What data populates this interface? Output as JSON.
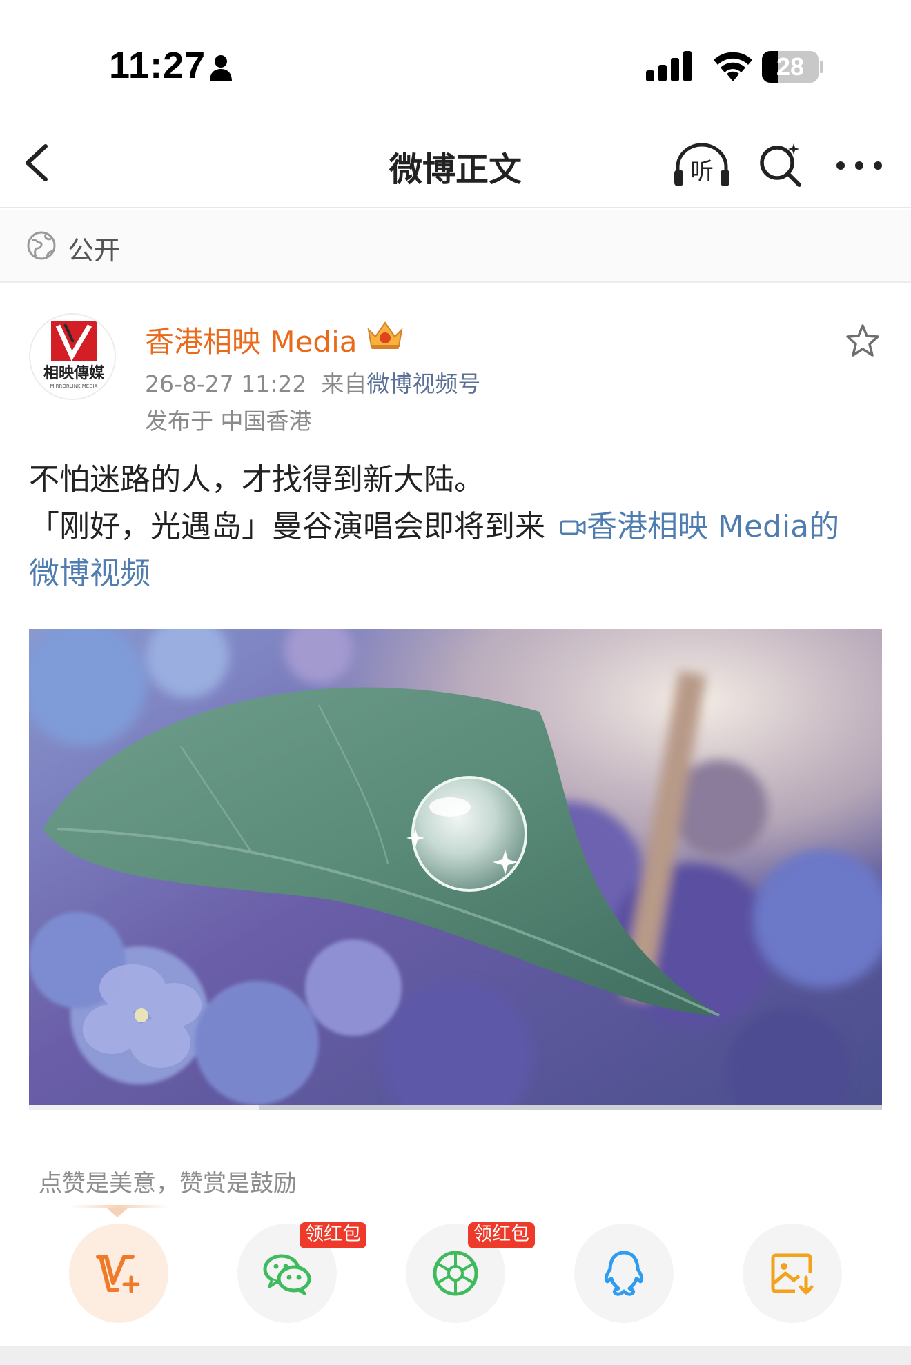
{
  "status_bar": {
    "time": "11:27",
    "battery": "28",
    "battery_fraction": 0.28,
    "icons": [
      "person-icon",
      "cellular-signal-icon",
      "wifi-icon",
      "battery-icon"
    ]
  },
  "nav": {
    "title": "微博正文",
    "listen_label": "听",
    "icons": [
      "back-icon",
      "listen-icon",
      "search-icon",
      "more-icon"
    ]
  },
  "visibility": {
    "label": "公开",
    "icon": "globe-icon"
  },
  "author": {
    "name": "香港相映 Media",
    "avatar_text": "相映傳媒",
    "avatar_subtext": "MIRRORLINK MEDIA",
    "badge_icon": "crown-icon"
  },
  "post": {
    "date": "26-8-27 11:22",
    "source_prefix": "来自",
    "source": "微博视频号",
    "location": "发布于 中国香港",
    "line1": "不怕迷路的人，才找得到新大陆。",
    "line2": "「刚好，光遇岛」曼谷演唱会即将到来",
    "video_link_part1": "香港相映 Media的",
    "video_link_part2": "微博视频"
  },
  "video": {
    "progress": 0.27
  },
  "reward": {
    "hint": "点赞是美意，赞赏是鼓励"
  },
  "share": {
    "badge_label": "领红包",
    "items": [
      {
        "name": "reward-button",
        "icon": "v-plus-icon",
        "color": "#ef7a2a",
        "has_badge": false
      },
      {
        "name": "wechat-share-button",
        "icon": "wechat-icon",
        "color": "#3fba5c",
        "has_badge": true
      },
      {
        "name": "moments-share-button",
        "icon": "moments-icon",
        "color": "#3fba5c",
        "has_badge": true
      },
      {
        "name": "qq-share-button",
        "icon": "qq-icon",
        "color": "#2f9cf0",
        "has_badge": false
      },
      {
        "name": "save-image-button",
        "icon": "save-image-icon",
        "color": "#f2a21c",
        "has_badge": false
      }
    ]
  },
  "colors": {
    "author_name": "#ea6a1c",
    "link": "#507daf",
    "badge": "#ee3a2a"
  }
}
